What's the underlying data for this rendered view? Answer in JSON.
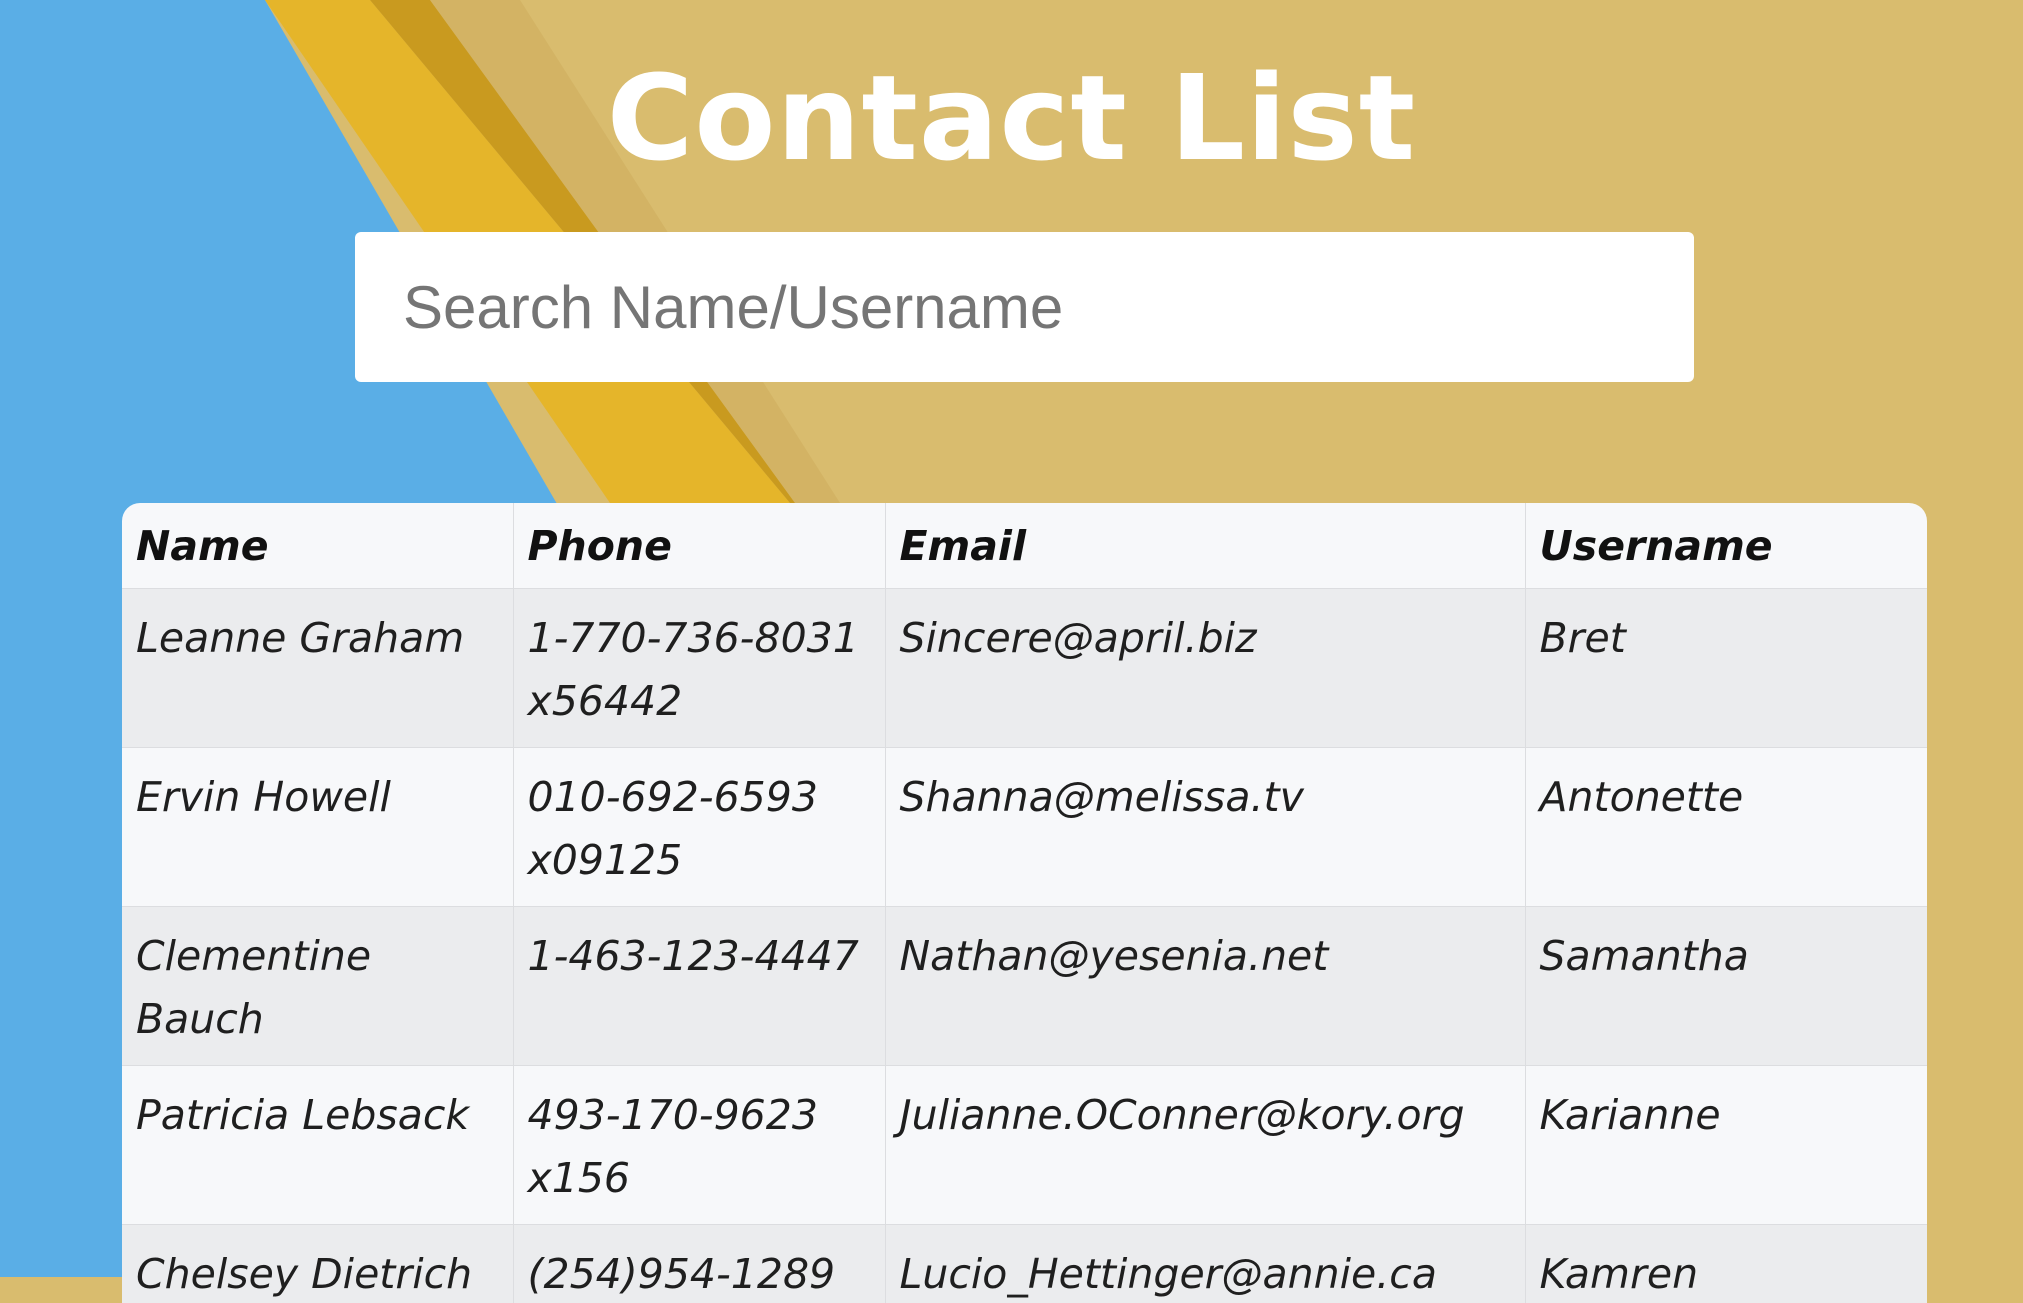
{
  "page": {
    "title": "Contact List"
  },
  "search": {
    "placeholder": "Search Name/Username",
    "value": ""
  },
  "table": {
    "headers": {
      "name": "Name",
      "phone": "Phone",
      "email": "Email",
      "username": "Username"
    },
    "rows": [
      {
        "name": "Leanne Graham",
        "phone": "1-770-736-8031 x56442",
        "email": "Sincere@april.biz",
        "username": "Bret"
      },
      {
        "name": "Ervin Howell",
        "phone": "010-692-6593 x09125",
        "email": "Shanna@melissa.tv",
        "username": "Antonette"
      },
      {
        "name": "Clementine Bauch",
        "phone": "1-463-123-4447",
        "email": "Nathan@yesenia.net",
        "username": "Samantha"
      },
      {
        "name": "Patricia Lebsack",
        "phone": "493-170-9623 x156",
        "email": "Julianne.OConner@kory.org",
        "username": "Karianne"
      },
      {
        "name": "Chelsey Dietrich",
        "phone": "(254)954-1289",
        "email": "Lucio_Hettinger@annie.ca",
        "username": "Kamren"
      }
    ]
  },
  "colors": {
    "background_blue": "#5aaee6",
    "background_paper": "#d9bc6e",
    "pencil_yellow": "#e5b52a",
    "title_text": "#ffffff",
    "row_odd": "#ebecee",
    "row_even": "#f7f8fa"
  }
}
